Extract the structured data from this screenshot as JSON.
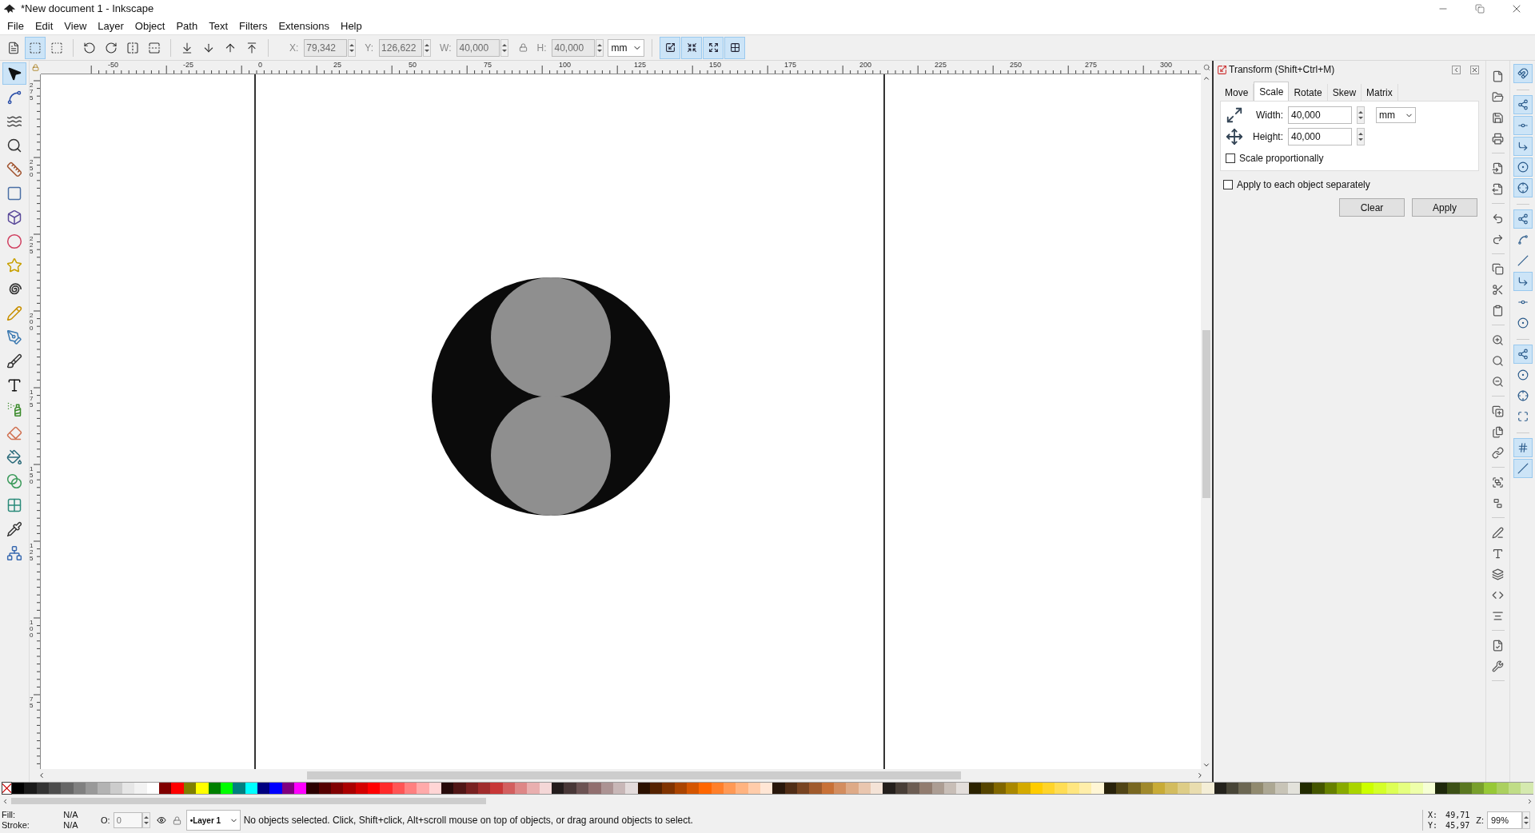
{
  "window": {
    "title": "*New document 1 - Inkscape"
  },
  "menu": [
    "File",
    "Edit",
    "View",
    "Layer",
    "Object",
    "Path",
    "Text",
    "Filters",
    "Extensions",
    "Help"
  ],
  "toolbar": {
    "buttons": [
      {
        "on": false
      },
      {
        "on": true
      },
      {
        "on": false
      },
      {
        "on": false
      },
      {
        "on": false
      },
      {
        "on": false
      },
      {
        "on": false
      },
      {
        "on": false
      },
      {
        "on": false
      },
      {
        "on": false
      },
      {
        "on": false
      }
    ],
    "fields": [
      {
        "label": "X:",
        "value": "79,342",
        "disabled": true
      },
      {
        "label": "Y:",
        "value": "126,622",
        "disabled": true
      },
      {
        "label": "W:",
        "value": "40,000",
        "disabled": true
      },
      {
        "label": "H:",
        "value": "40,000",
        "disabled": true
      }
    ],
    "unit": "mm",
    "affect_toggles": [
      {
        "on": true
      },
      {
        "on": true
      },
      {
        "on": true
      },
      {
        "on": true
      }
    ]
  },
  "tools": [
    {
      "selected": true
    },
    {
      "selected": false
    },
    {
      "selected": false
    },
    {
      "selected": false
    },
    {
      "selected": false
    },
    {
      "selected": false
    },
    {
      "selected": false
    },
    {
      "selected": false
    },
    {
      "selected": false
    },
    {
      "selected": false
    },
    {
      "selected": false
    },
    {
      "selected": false
    },
    {
      "selected": false
    },
    {
      "selected": false
    },
    {
      "selected": false
    },
    {
      "selected": false
    },
    {
      "selected": false
    },
    {
      "selected": false
    },
    {
      "selected": false
    },
    {
      "selected": false
    },
    {
      "selected": false
    }
  ],
  "rulers": {
    "horizontal": [
      "-50",
      "-25",
      "0",
      "25",
      "50",
      "75",
      "100",
      "125",
      "150",
      "175",
      "200",
      "225",
      "250",
      "275",
      "300"
    ],
    "vertical": [
      "275",
      "250",
      "225",
      "200",
      "175",
      "150",
      "125",
      "100",
      "75"
    ]
  },
  "dialog": {
    "title": "Transform (Shift+Ctrl+M)",
    "tabs": [
      {
        "label": "Move",
        "selected": false
      },
      {
        "label": "Scale",
        "selected": true
      },
      {
        "label": "Rotate",
        "selected": false
      },
      {
        "label": "Skew",
        "selected": false
      },
      {
        "label": "Matrix",
        "selected": false
      }
    ],
    "fields": [
      {
        "label": "Width:",
        "value": "40,000"
      },
      {
        "label": "Height:",
        "value": "40,000"
      }
    ],
    "unit": "mm",
    "checkboxes": [
      {
        "label": "Scale proportionally",
        "checked": false
      },
      {
        "label": "Apply to each object separately",
        "checked": false
      }
    ],
    "buttons": [
      "Clear",
      "Apply"
    ]
  },
  "snap": [
    {
      "on": true
    },
    {
      "on": true
    },
    {
      "on": true
    },
    {
      "on": true
    },
    {
      "on": true
    },
    {
      "on": true
    },
    {
      "on": true
    },
    {
      "on": false
    },
    {
      "on": false
    },
    {
      "on": true
    },
    {
      "on": false
    },
    {
      "on": false
    },
    {
      "on": true
    },
    {
      "on": false
    },
    {
      "on": false
    },
    {
      "on": false
    },
    {
      "on": true
    },
    {
      "on": true
    }
  ],
  "palette": [
    {
      "color": "#000000"
    },
    {
      "color": "#1a1a1a"
    },
    {
      "color": "#333333"
    },
    {
      "color": "#4d4d4d"
    },
    {
      "color": "#666666"
    },
    {
      "color": "#808080"
    },
    {
      "color": "#999999"
    },
    {
      "color": "#b3b3b3"
    },
    {
      "color": "#cccccc"
    },
    {
      "color": "#e6e6e6"
    },
    {
      "color": "#f2f2f2"
    },
    {
      "color": "#ffffff"
    },
    {
      "color": "#800000"
    },
    {
      "color": "#ff0000"
    },
    {
      "color": "#808000"
    },
    {
      "color": "#ffff00"
    },
    {
      "color": "#008000"
    },
    {
      "color": "#00ff00"
    },
    {
      "color": "#008080"
    },
    {
      "color": "#00ffff"
    },
    {
      "color": "#000080"
    },
    {
      "color": "#0000ff"
    },
    {
      "color": "#800080"
    },
    {
      "color": "#ff00ff"
    },
    {
      "color": "#2b0000"
    },
    {
      "color": "#550000"
    },
    {
      "color": "#800001"
    },
    {
      "color": "#aa0000"
    },
    {
      "color": "#d40000"
    },
    {
      "color": "#ff0001"
    },
    {
      "color": "#ff2a2a"
    },
    {
      "color": "#ff5555"
    },
    {
      "color": "#ff8080"
    },
    {
      "color": "#ffaaaa"
    },
    {
      "color": "#ffd5d5"
    },
    {
      "color": "#280b0b"
    },
    {
      "color": "#501616"
    },
    {
      "color": "#782121"
    },
    {
      "color": "#a02c2c"
    },
    {
      "color": "#c83737"
    },
    {
      "color": "#d35f5f"
    },
    {
      "color": "#de8787"
    },
    {
      "color": "#e9afaf"
    },
    {
      "color": "#f4d7d7"
    },
    {
      "color": "#241c1c"
    },
    {
      "color": "#483737"
    },
    {
      "color": "#6c5353"
    },
    {
      "color": "#916f6f"
    },
    {
      "color": "#ac9393"
    },
    {
      "color": "#c8b7b7"
    },
    {
      "color": "#e3dbdb"
    },
    {
      "color": "#2b1100"
    },
    {
      "color": "#552200"
    },
    {
      "color": "#803300"
    },
    {
      "color": "#aa4400"
    },
    {
      "color": "#d45500"
    },
    {
      "color": "#ff6600"
    },
    {
      "color": "#ff7f2a"
    },
    {
      "color": "#ff9955"
    },
    {
      "color": "#ffb380"
    },
    {
      "color": "#ffccaa"
    },
    {
      "color": "#ffe6d5"
    },
    {
      "color": "#28170b"
    },
    {
      "color": "#502d16"
    },
    {
      "color": "#784421"
    },
    {
      "color": "#a05a2c"
    },
    {
      "color": "#c87137"
    },
    {
      "color": "#d38d5f"
    },
    {
      "color": "#deaa87"
    },
    {
      "color": "#e9c6af"
    },
    {
      "color": "#f4e3d7"
    },
    {
      "color": "#241f1c"
    },
    {
      "color": "#483e37"
    },
    {
      "color": "#6c5d53"
    },
    {
      "color": "#917c6f"
    },
    {
      "color": "#ac9d93"
    },
    {
      "color": "#c8beb7"
    },
    {
      "color": "#e3dedb"
    },
    {
      "color": "#2b2200"
    },
    {
      "color": "#554400"
    },
    {
      "color": "#806600"
    },
    {
      "color": "#aa8800"
    },
    {
      "color": "#d4aa00"
    },
    {
      "color": "#ffcc00"
    },
    {
      "color": "#ffd42a"
    },
    {
      "color": "#ffdd55"
    },
    {
      "color": "#ffe680"
    },
    {
      "color": "#ffeeaa"
    },
    {
      "color": "#fff6d5"
    },
    {
      "color": "#28220b"
    },
    {
      "color": "#504416"
    },
    {
      "color": "#786721"
    },
    {
      "color": "#a0892c"
    },
    {
      "color": "#c8ab37"
    },
    {
      "color": "#d3bc5f"
    },
    {
      "color": "#decd87"
    },
    {
      "color": "#e9ddaf"
    },
    {
      "color": "#f4eed7"
    },
    {
      "color": "#24221c"
    },
    {
      "color": "#484537"
    },
    {
      "color": "#6c6753"
    },
    {
      "color": "#918a6f"
    },
    {
      "color": "#aca793"
    },
    {
      "color": "#c8c4b7"
    },
    {
      "color": "#e3e2db"
    },
    {
      "color": "#222b00"
    },
    {
      "color": "#445500"
    },
    {
      "color": "#668000"
    },
    {
      "color": "#88aa00"
    },
    {
      "color": "#aad400"
    },
    {
      "color": "#ccff00"
    },
    {
      "color": "#d4ff2a"
    },
    {
      "color": "#ddff55"
    },
    {
      "color": "#e5ff80"
    },
    {
      "color": "#eeffaa"
    },
    {
      "color": "#f6ffd5"
    },
    {
      "color": "#1e280b"
    },
    {
      "color": "#3c5016"
    },
    {
      "color": "#5a7821"
    },
    {
      "color": "#789f2c"
    },
    {
      "color": "#97c837"
    },
    {
      "color": "#abd05f"
    },
    {
      "color": "#c0dd87"
    },
    {
      "color": "#d5e9af"
    }
  ],
  "status_bar": {
    "fill": {
      "label": "Fill:",
      "value": "N/A"
    },
    "stroke": {
      "label": "Stroke:",
      "value": "N/A"
    },
    "opacity": {
      "label": "O:",
      "value": "0"
    },
    "layer": "•Layer 1",
    "message": "No objects selected. Click, Shift+click, Alt+scroll mouse on top of objects, or drag around objects to select.",
    "cursor": [
      {
        "label": "X:",
        "value": "49,71"
      },
      {
        "label": "Y:",
        "value": "45,97"
      }
    ],
    "zoom": {
      "label": "Z:",
      "value": "99%"
    }
  }
}
